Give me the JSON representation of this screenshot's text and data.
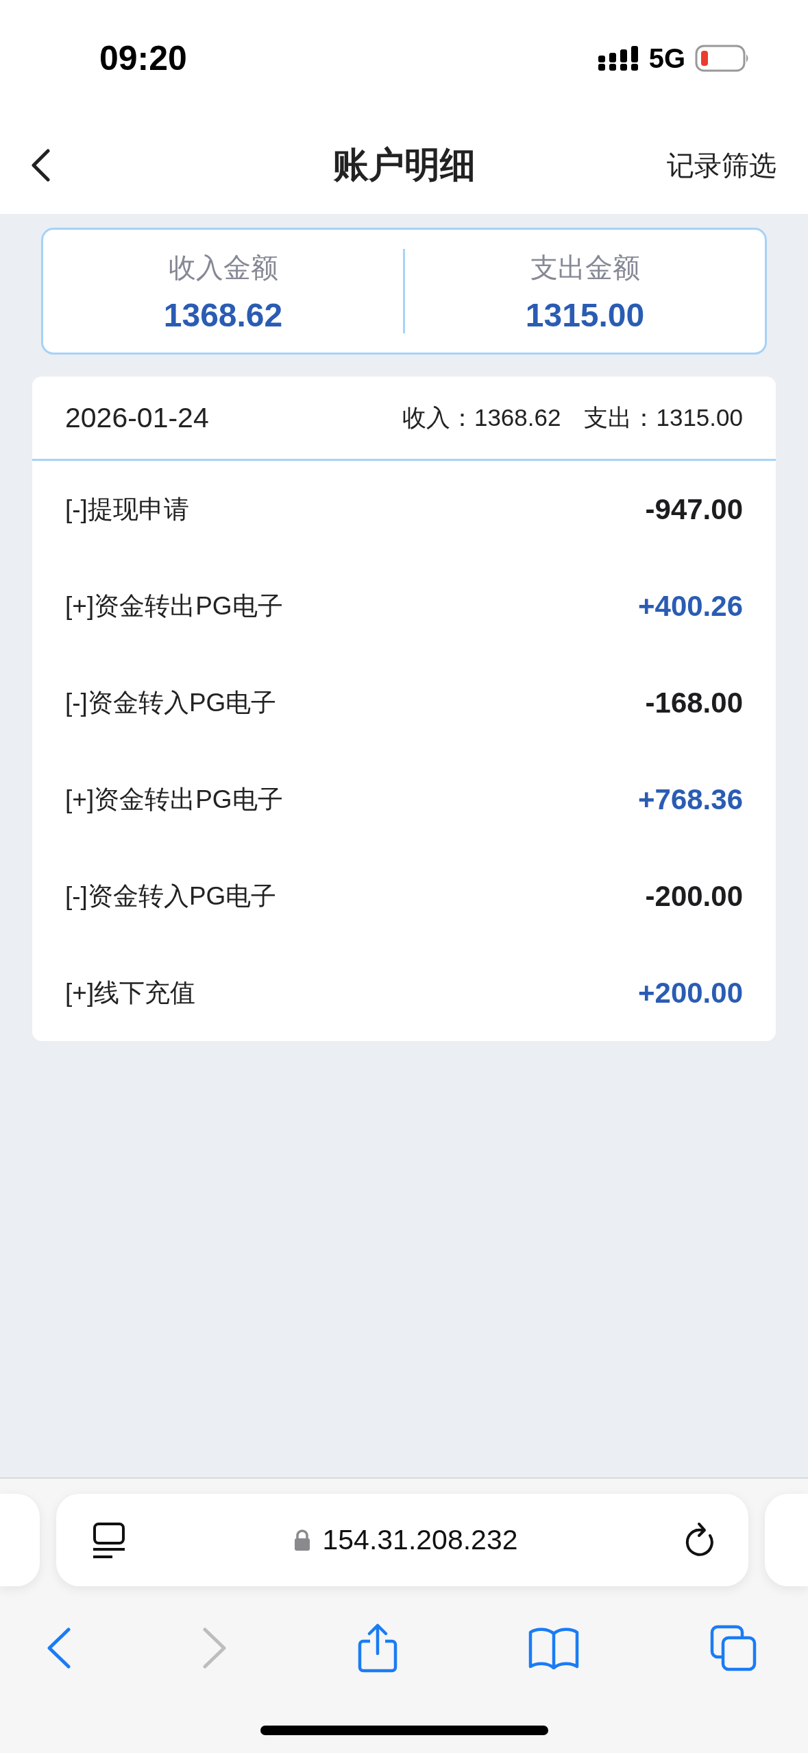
{
  "status_bar": {
    "time": "09:20",
    "network": "5G"
  },
  "nav": {
    "title": "账户明细",
    "action": "记录筛选"
  },
  "summary": [
    {
      "label": "收入金额",
      "value": "1368.62"
    },
    {
      "label": "支出金额",
      "value": "1315.00"
    }
  ],
  "day": {
    "date": "2026-01-24",
    "income_label": "收入：",
    "income": "1368.62",
    "expense_label": "支出：",
    "expense": "1315.00",
    "rows": [
      {
        "label": "[-]提现申请",
        "amount": "-947.00",
        "kind": "expense"
      },
      {
        "label": "[+]资金转出PG电子",
        "amount": "+400.26",
        "kind": "income"
      },
      {
        "label": "[-]资金转入PG电子",
        "amount": "-168.00",
        "kind": "expense"
      },
      {
        "label": "[+]资金转出PG电子",
        "amount": "+768.36",
        "kind": "income"
      },
      {
        "label": "[-]资金转入PG电子",
        "amount": "-200.00",
        "kind": "expense"
      },
      {
        "label": "[+]线下充值",
        "amount": "+200.00",
        "kind": "income"
      }
    ]
  },
  "browser": {
    "url": "154.31.208.232"
  }
}
